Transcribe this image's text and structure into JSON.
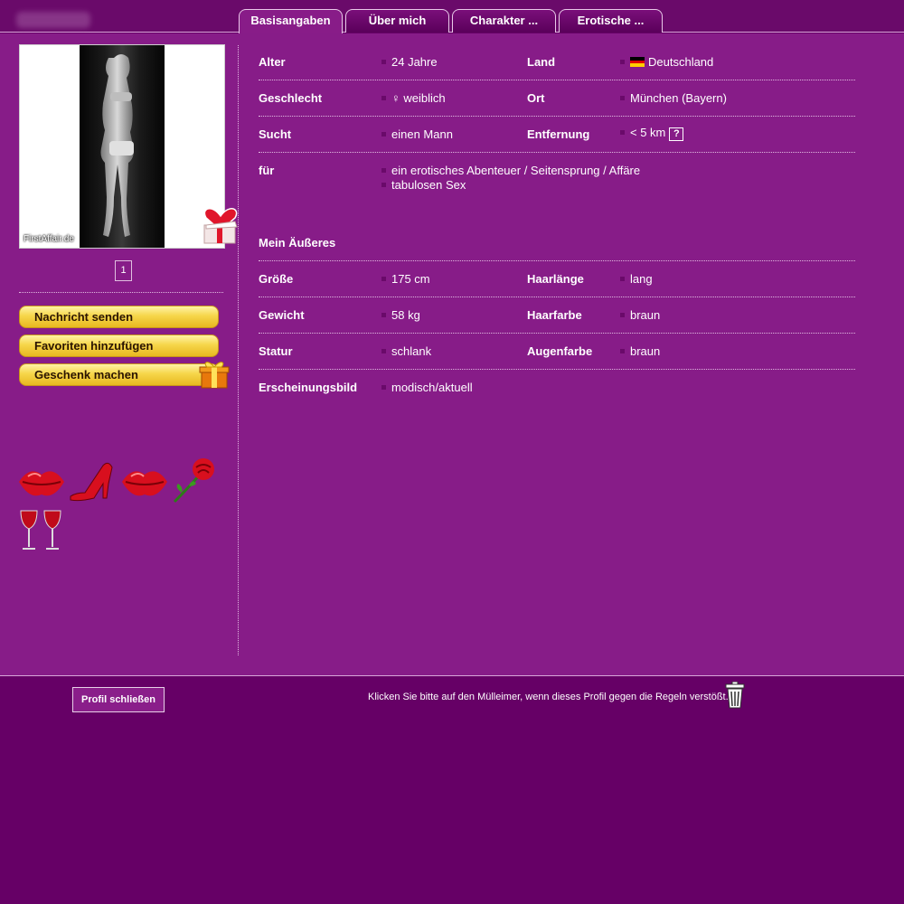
{
  "tabs": [
    {
      "label": "Basisangaben",
      "active": true
    },
    {
      "label": "Über mich",
      "active": false
    },
    {
      "label": "Charakter ...",
      "active": false
    },
    {
      "label": "Erotische ...",
      "active": false
    }
  ],
  "photo": {
    "watermark": "FirstAffair.de",
    "page": "1"
  },
  "actions": {
    "message": "Nachricht senden",
    "favorite": "Favoriten hinzufügen",
    "gift": "Geschenk machen"
  },
  "smileys": [
    "kiss-lips-icon",
    "red-high-heel-icon",
    "kiss-lips-icon",
    "red-rose-icon",
    "wine-glasses-icon"
  ],
  "basics": {
    "alter_label": "Alter",
    "alter": "24 Jahre",
    "land_label": "Land",
    "land": "Deutschland",
    "geschlecht_label": "Geschlecht",
    "geschlecht": "♀ weiblich",
    "ort_label": "Ort",
    "ort": "München (Bayern)",
    "sucht_label": "Sucht",
    "sucht": "einen Mann",
    "entfernung_label": "Entfernung",
    "entfernung": "< 5 km",
    "help": "?",
    "fuer_label": "für",
    "fuer_1": "ein erotisches Abenteuer / Seitensprung / Affäre",
    "fuer_2": "tabulosen Sex"
  },
  "appearance": {
    "title": "Mein Äußeres",
    "groesse_label": "Größe",
    "groesse": "175 cm",
    "haarlaenge_label": "Haarlänge",
    "haarlaenge": "lang",
    "gewicht_label": "Gewicht",
    "gewicht": "58 kg",
    "haarfarbe_label": "Haarfarbe",
    "haarfarbe": "braun",
    "statur_label": "Statur",
    "statur": "schlank",
    "augenfarbe_label": "Augenfarbe",
    "augenfarbe": "braun",
    "erscheinung_label": "Erscheinungsbild",
    "erscheinung": "modisch/aktuell"
  },
  "footer": {
    "close": "Profil schließen",
    "report": "Klicken Sie bitte auf den Mülleimer, wenn dieses Profil gegen die Regeln verstößt."
  },
  "colors": {
    "background": "#660066",
    "panel": "#871c88",
    "button_gold": "#f6d64a"
  }
}
